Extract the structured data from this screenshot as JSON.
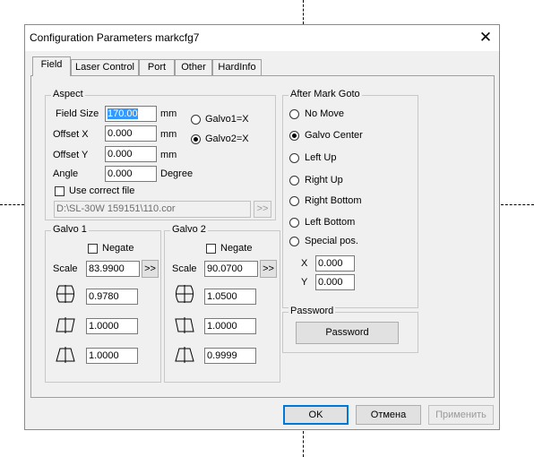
{
  "window": {
    "title": "Configuration Parameters markcfg7",
    "close_glyph": "✕"
  },
  "tabs": [
    {
      "label": "Field"
    },
    {
      "label": "Laser Control"
    },
    {
      "label": "Port"
    },
    {
      "label": "Other"
    },
    {
      "label": "HardInfo"
    }
  ],
  "aspect": {
    "group_label": "Aspect",
    "field_size": {
      "label": "Field Size",
      "value": "170.00",
      "unit": "mm"
    },
    "offset_x": {
      "label": "Offset X",
      "value": "0.000",
      "unit": "mm"
    },
    "offset_y": {
      "label": "Offset Y",
      "value": "0.000",
      "unit": "mm"
    },
    "angle": {
      "label": "Angle",
      "value": "0.000",
      "unit": "Degree"
    },
    "galvo1_x": {
      "label": "Galvo1=X",
      "checked": false
    },
    "galvo2_x": {
      "label": "Galvo2=X",
      "checked": true
    },
    "use_correct_file": {
      "label": "Use correct file",
      "checked": false
    },
    "correct_file_path": "D:\\SL-30W 159151\\110.cor",
    "browse_label": ">>"
  },
  "galvo1": {
    "group_label": "Galvo 1",
    "negate_label": "Negate",
    "scale_label": "Scale",
    "scale_value": "83.9900",
    "scale_button": ">>",
    "barrel_value": "0.9780",
    "parallelogram_value": "1.0000",
    "trapezoid_value": "1.0000"
  },
  "galvo2": {
    "group_label": "Galvo 2",
    "negate_label": "Negate",
    "scale_label": "Scale",
    "scale_value": "90.0700",
    "scale_button": ">>",
    "barrel_value": "1.0500",
    "parallelogram_value": "1.0000",
    "trapezoid_value": "0.9999"
  },
  "after_mark": {
    "group_label": "After Mark Goto",
    "options": [
      {
        "label": "No Move",
        "checked": false
      },
      {
        "label": "Galvo Center",
        "checked": true
      },
      {
        "label": "Left Up",
        "checked": false
      },
      {
        "label": "Right Up",
        "checked": false
      },
      {
        "label": "Right Bottom",
        "checked": false
      },
      {
        "label": "Left Bottom",
        "checked": false
      },
      {
        "label": "Special pos.",
        "checked": false
      }
    ],
    "x_label": "X",
    "x_value": "0.000",
    "y_label": "Y",
    "y_value": "0.000"
  },
  "password": {
    "group_label": "Password",
    "button_label": "Password"
  },
  "footer": {
    "ok_label": "OK",
    "cancel_label": "Отмена",
    "apply_label": "Применить"
  }
}
